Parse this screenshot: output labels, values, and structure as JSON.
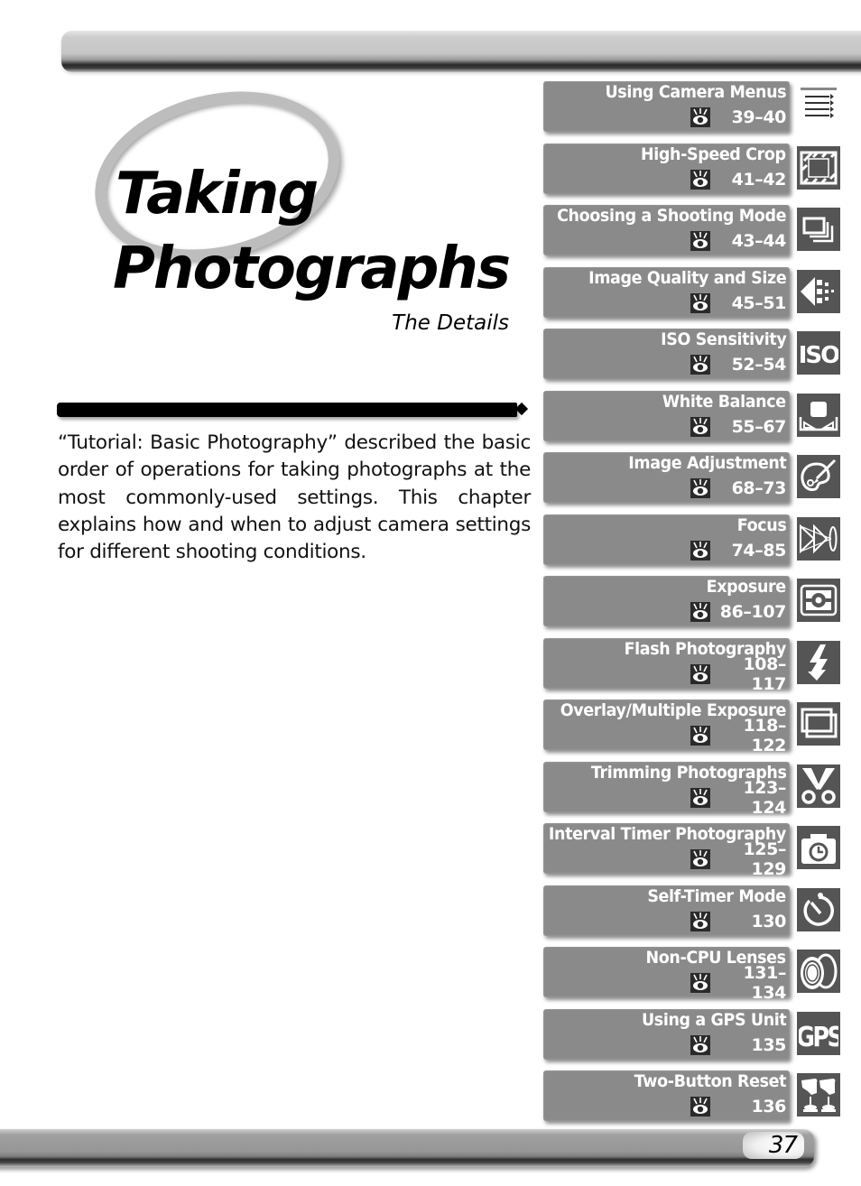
{
  "chapter": {
    "title_line_1": "Taking",
    "title_line_2": "Photographs",
    "subtitle": "The Details"
  },
  "intro": {
    "text": "“Tutorial: Basic Photography” described the basic order of operations for taking photographs at the most commonly-used settings.  This chapter explains how and when to adjust camera settings for different shooting conditions."
  },
  "toc": {
    "reference_icon": "page-reference-eye-icon",
    "items": [
      {
        "label": "Using Camera Menus",
        "pages": "39–40",
        "icon": "menu-list-icon"
      },
      {
        "label": "High-Speed Crop",
        "pages": "41–42",
        "icon": "crop-frame-icon"
      },
      {
        "label": "Choosing a Shooting Mode",
        "pages": "43–44",
        "icon": "stacked-frames-icon"
      },
      {
        "label": "Image Quality and Size",
        "pages": "45–51",
        "icon": "image-quality-icon"
      },
      {
        "label": "ISO Sensitivity",
        "pages": "52–54",
        "icon": "iso-icon"
      },
      {
        "label": "White Balance",
        "pages": "55–67",
        "icon": "white-balance-icon"
      },
      {
        "label": "Image Adjustment",
        "pages": "68–73",
        "icon": "palette-icon"
      },
      {
        "label": "Focus",
        "pages": "74–85",
        "icon": "focus-icon"
      },
      {
        "label": "Exposure",
        "pages": "86–107",
        "icon": "metering-icon"
      },
      {
        "label": "Flash Photography",
        "pages": "108–117",
        "icon": "flash-icon"
      },
      {
        "label": "Overlay/Multiple Exposure",
        "pages": "118–122",
        "icon": "overlay-icon"
      },
      {
        "label": "Trimming Photographs",
        "pages": "123–124",
        "icon": "scissors-icon"
      },
      {
        "label": "Interval Timer Photography",
        "pages": "125–129",
        "icon": "interval-timer-icon"
      },
      {
        "label": "Self-Timer Mode",
        "pages": "130",
        "icon": "self-timer-icon"
      },
      {
        "label": "Non-CPU Lenses",
        "pages": "131–134",
        "icon": "lens-icon"
      },
      {
        "label": "Using a GPS Unit",
        "pages": "135",
        "icon": "gps-icon"
      },
      {
        "label": "Two-Button Reset",
        "pages": "136",
        "icon": "two-button-reset-icon"
      }
    ]
  },
  "icon_text": {
    "iso": "ISO",
    "gps": "GPS"
  },
  "footer": {
    "page_number": "37"
  }
}
